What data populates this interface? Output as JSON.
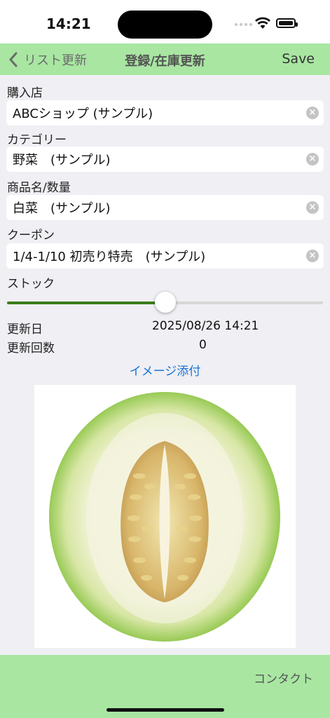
{
  "status": {
    "time": "14:21"
  },
  "nav": {
    "back_label": "リスト更新",
    "title": "登録/在庫更新",
    "save_label": "Save"
  },
  "fields": [
    {
      "label": "購入店",
      "value": "ABCショップ (サンプル)"
    },
    {
      "label": "カテゴリー",
      "value": "野菜　(サンプル)"
    },
    {
      "label": "商品名/数量",
      "value": "白菜　(サンプル)"
    },
    {
      "label": "クーポン",
      "value": "1/4-1/10 初売り特売　(サンプル)"
    }
  ],
  "stock": {
    "label": "ストック",
    "level": 0.5
  },
  "info": {
    "updated_label": "更新日",
    "updated_value": "2025/08/26 14:21",
    "count_label": "更新回数",
    "count_value": "0"
  },
  "attach_label": "イメージ添付",
  "footer": {
    "contact_label": "コンタクト"
  },
  "colors": {
    "bar_green": "#a8e6a2",
    "link_blue": "#1a73d9",
    "slider_green": "#3a7d1a"
  },
  "icons": {
    "back": "chevron-left-icon",
    "clear": "clear-circle-icon"
  }
}
